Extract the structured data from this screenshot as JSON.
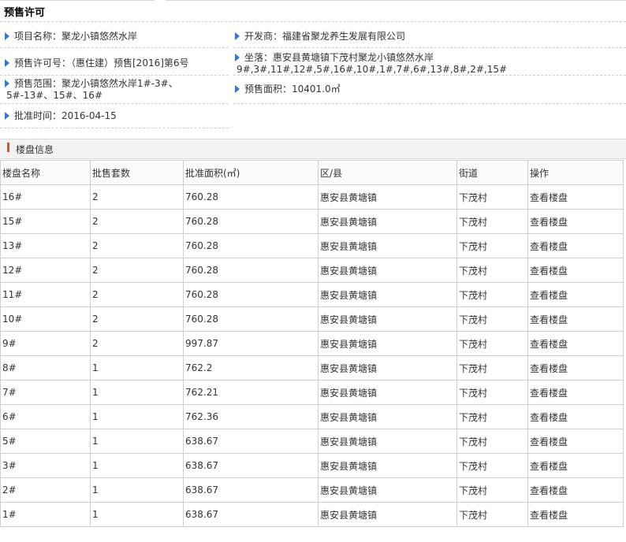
{
  "section_title": "预售许可",
  "info": {
    "project_name": "项目名称：聚龙小镇悠然水岸",
    "developer": "开发商：福建省聚龙养生发展有限公司",
    "permit_no": "预售许可号：（惠住建）预售[2016]第6号",
    "location_line1": "坐落：惠安县黄塘镇下茂村聚龙小镇悠然水岸",
    "location_line2": "9#,3#,11#,12#,5#,16#,10#,1#,7#,6#,13#,8#,2#,15#",
    "scope_line1": "预售范围：聚龙小镇悠然水岸1#-3#、",
    "scope_line2": "5#-13#、15#、16#",
    "area": "预售面积：10401.0㎡",
    "approval_time": "批准时间：2016-04-15"
  },
  "panel_title": "楼盘信息",
  "table": {
    "headers": [
      "楼盘名称",
      "批售套数",
      "批准面积(㎡)",
      "区/县",
      "街道",
      "操作"
    ],
    "rows": [
      [
        "16#",
        "2",
        "760.28",
        "惠安县黄塘镇",
        "下茂村",
        "查看楼盘"
      ],
      [
        "15#",
        "2",
        "760.28",
        "惠安县黄塘镇",
        "下茂村",
        "查看楼盘"
      ],
      [
        "13#",
        "2",
        "760.28",
        "惠安县黄塘镇",
        "下茂村",
        "查看楼盘"
      ],
      [
        "12#",
        "2",
        "760.28",
        "惠安县黄塘镇",
        "下茂村",
        "查看楼盘"
      ],
      [
        "11#",
        "2",
        "760.28",
        "惠安县黄塘镇",
        "下茂村",
        "查看楼盘"
      ],
      [
        "10#",
        "2",
        "760.28",
        "惠安县黄塘镇",
        "下茂村",
        "查看楼盘"
      ],
      [
        "9#",
        "2",
        "997.87",
        "惠安县黄塘镇",
        "下茂村",
        "查看楼盘"
      ],
      [
        "8#",
        "1",
        "762.2",
        "惠安县黄塘镇",
        "下茂村",
        "查看楼盘"
      ],
      [
        "7#",
        "1",
        "762.21",
        "惠安县黄塘镇",
        "下茂村",
        "查看楼盘"
      ],
      [
        "6#",
        "1",
        "762.36",
        "惠安县黄塘镇",
        "下茂村",
        "查看楼盘"
      ],
      [
        "5#",
        "1",
        "638.67",
        "惠安县黄塘镇",
        "下茂村",
        "查看楼盘"
      ],
      [
        "3#",
        "1",
        "638.67",
        "惠安县黄塘镇",
        "下茂村",
        "查看楼盘"
      ],
      [
        "2#",
        "1",
        "638.67",
        "惠安县黄塘镇",
        "下茂村",
        "查看楼盘"
      ],
      [
        "1#",
        "1",
        "638.67",
        "惠安县黄塘镇",
        "下茂村",
        "查看楼盘"
      ]
    ]
  }
}
